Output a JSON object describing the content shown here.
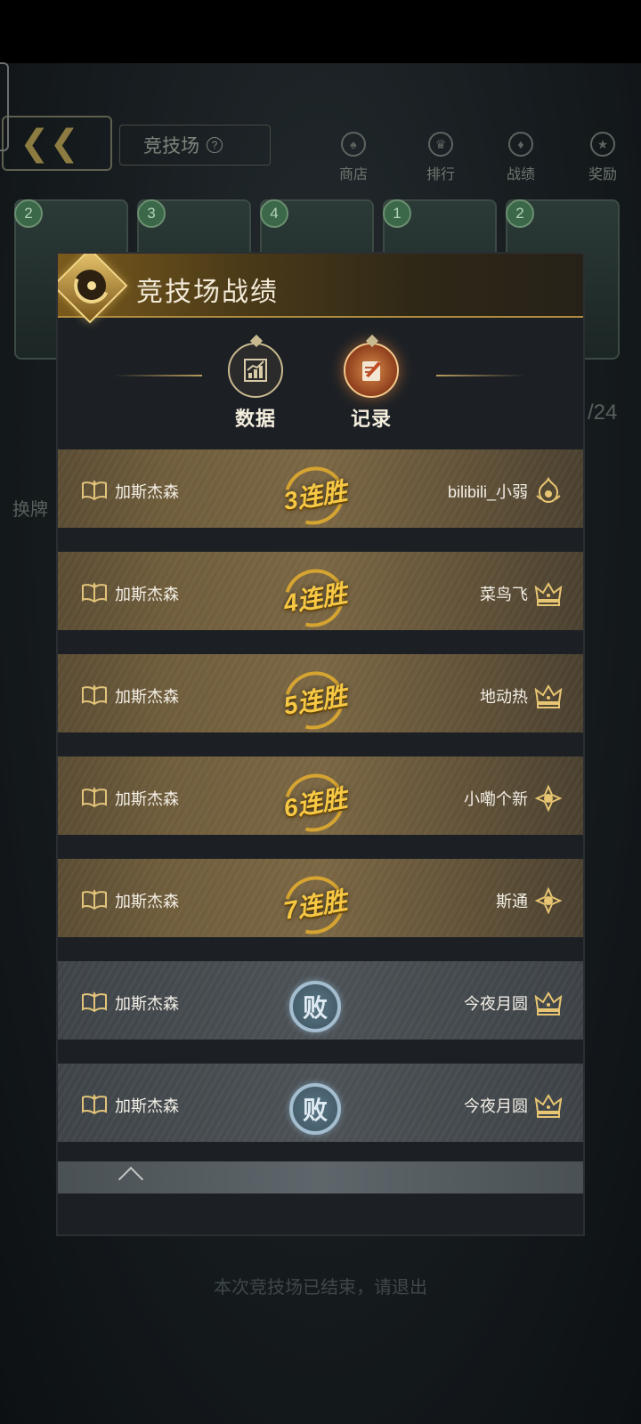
{
  "background": {
    "title": "竞技场",
    "nav": [
      {
        "label": "商店"
      },
      {
        "label": "排行"
      },
      {
        "label": "战绩"
      },
      {
        "label": "奖励"
      }
    ],
    "card_costs": [
      "2",
      "3",
      "4",
      "1",
      "2"
    ],
    "left_label": "换牌",
    "counter": "/24",
    "footer": "本次竞技场已结束，请退出"
  },
  "panel": {
    "title": "竞技场战绩",
    "tabs": [
      {
        "label": "数据",
        "active": false
      },
      {
        "label": "记录",
        "active": true
      }
    ]
  },
  "records": [
    {
      "player": "加斯杰森",
      "result": "win",
      "streak": "3连胜",
      "opponent": "bilibili_小弱",
      "rank_icon": "flame-rank-icon"
    },
    {
      "player": "加斯杰森",
      "result": "win",
      "streak": "4连胜",
      "opponent": "菜鸟飞",
      "rank_icon": "crown-rank-icon"
    },
    {
      "player": "加斯杰森",
      "result": "win",
      "streak": "5连胜",
      "opponent": "地动热",
      "rank_icon": "crown-rank-icon"
    },
    {
      "player": "加斯杰森",
      "result": "win",
      "streak": "6连胜",
      "opponent": "小嘞个新",
      "rank_icon": "sun-rank-icon"
    },
    {
      "player": "加斯杰森",
      "result": "win",
      "streak": "7连胜",
      "opponent": "斯通",
      "rank_icon": "sun-rank-icon"
    },
    {
      "player": "加斯杰森",
      "result": "loss",
      "streak": "败",
      "opponent": "今夜月圆",
      "rank_icon": "crown-rank-icon"
    },
    {
      "player": "加斯杰森",
      "result": "loss",
      "streak": "败",
      "opponent": "今夜月圆",
      "rank_icon": "crown-rank-icon"
    }
  ],
  "colors": {
    "gold": "#f7c843",
    "panel_bg": "#1c2025",
    "win_row": "#7a6643",
    "loss_row": "#4c5256",
    "loss_seal": "#a4bed0"
  }
}
